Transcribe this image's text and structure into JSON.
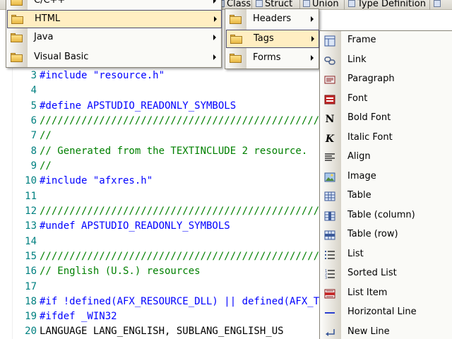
{
  "toolbar": {
    "items": [
      {
        "label": "Class",
        "icon": "class-icon"
      },
      {
        "label": "Struct",
        "icon": "struct-icon"
      },
      {
        "label": "Union",
        "icon": "union-icon"
      },
      {
        "label": "Type Definition",
        "icon": "typedef-icon"
      }
    ]
  },
  "editor": {
    "lines": [
      {
        "num": "3",
        "text": "#include \"resource.h\"",
        "kind": "pre"
      },
      {
        "num": "4",
        "text": "",
        "kind": "plain"
      },
      {
        "num": "5",
        "text": "#define APSTUDIO_READONLY_SYMBOLS",
        "kind": "pre"
      },
      {
        "num": "6",
        "text": "////////////////////////////////////////////////////////////////",
        "kind": "com"
      },
      {
        "num": "7",
        "text": "//",
        "kind": "com"
      },
      {
        "num": "8",
        "text": "// Generated from the TEXTINCLUDE 2 resource.",
        "kind": "com"
      },
      {
        "num": "9",
        "text": "//",
        "kind": "com"
      },
      {
        "num": "10",
        "text": "#include \"afxres.h\"",
        "kind": "pre"
      },
      {
        "num": "11",
        "text": "",
        "kind": "plain"
      },
      {
        "num": "12",
        "text": "////////////////////////////////////////////////////////////////",
        "kind": "com"
      },
      {
        "num": "13",
        "text": "#undef APSTUDIO_READONLY_SYMBOLS",
        "kind": "pre"
      },
      {
        "num": "14",
        "text": "",
        "kind": "plain"
      },
      {
        "num": "15",
        "text": "////////////////////////////////////////////////////////////////",
        "kind": "com"
      },
      {
        "num": "16",
        "text": "// English (U.S.) resources",
        "kind": "com"
      },
      {
        "num": "17",
        "text": "",
        "kind": "plain"
      },
      {
        "num": "18",
        "text": "#if !defined(AFX_RESOURCE_DLL) || defined(AFX_TARG_ENU)",
        "kind": "pre"
      },
      {
        "num": "19",
        "text": "#ifdef _WIN32",
        "kind": "pre"
      },
      {
        "num": "20",
        "text": "LANGUAGE LANG_ENGLISH, SUBLANG_ENGLISH_US",
        "kind": "plain"
      }
    ]
  },
  "menu1": {
    "items": [
      {
        "label": "C/C++",
        "hl": false
      },
      {
        "label": "HTML",
        "hl": true
      },
      {
        "label": "Java",
        "hl": false
      },
      {
        "label": "Visual Basic",
        "hl": false
      }
    ]
  },
  "menu2": {
    "items": [
      {
        "label": "Headers",
        "hl": false
      },
      {
        "label": "Tags",
        "hl": true
      },
      {
        "label": "Forms",
        "hl": false
      }
    ]
  },
  "menu3": {
    "items": [
      {
        "label": "Frame",
        "icon": "frame-icon"
      },
      {
        "label": "Link",
        "icon": "link-icon"
      },
      {
        "label": "Paragraph",
        "icon": "paragraph-icon"
      },
      {
        "label": "Font",
        "icon": "font-icon"
      },
      {
        "label": "Bold Font",
        "icon": "bold-font-icon"
      },
      {
        "label": "Italic Font",
        "icon": "italic-font-icon"
      },
      {
        "label": "Align",
        "icon": "align-icon"
      },
      {
        "label": "Image",
        "icon": "image-icon"
      },
      {
        "label": "Table",
        "icon": "table-icon"
      },
      {
        "label": "Table (column)",
        "icon": "table-column-icon"
      },
      {
        "label": "Table (row)",
        "icon": "table-row-icon"
      },
      {
        "label": "List",
        "icon": "list-icon"
      },
      {
        "label": "Sorted List",
        "icon": "sorted-list-icon"
      },
      {
        "label": "List Item",
        "icon": "list-item-icon"
      },
      {
        "label": "Horizontal Line",
        "icon": "horizontal-line-icon"
      },
      {
        "label": "New Line",
        "icon": "new-line-icon"
      }
    ]
  },
  "colors": {
    "preprocessor": "#0000ff",
    "comment": "#008000",
    "line_number": "#008080",
    "menu_highlight": "#ffeec2"
  }
}
